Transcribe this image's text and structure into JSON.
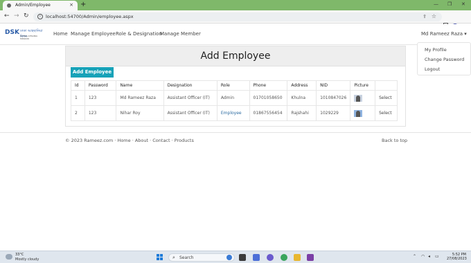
{
  "browser": {
    "tab_title": "Admin/Employee",
    "tab_close": "×",
    "new_tab": "+",
    "url": "localhost:54700/Admin/employee.aspx",
    "profile_initial": "P"
  },
  "site": {
    "logo_mark": "DSK",
    "logo_bengali": "ঢাকা আহছানিয়া মিশন",
    "logo_sub": "DHAKA AHSANIA MISSION",
    "nav": [
      "Home",
      "Manage Employee",
      "Role & Designation",
      "Manage Member"
    ],
    "user_name": "Md Rameez Raza",
    "user_caret": "▾",
    "dropdown": [
      "My Profile",
      "Change Password",
      "Logout"
    ]
  },
  "page": {
    "title": "Add Employee",
    "add_button": "Add Employee",
    "columns": [
      "Id",
      "Password",
      "Name",
      "Designation",
      "Role",
      "Phone",
      "Address",
      "NID",
      "Picture",
      ""
    ],
    "rows": [
      {
        "id": "1",
        "password": "123",
        "name": "Md Rameez Raza",
        "designation": "Assistant Officer (IT)",
        "role": "Admin",
        "phone": "01701058650",
        "address": "Khulna",
        "nid": "1010847026",
        "action": "Select"
      },
      {
        "id": "2",
        "password": "123",
        "name": "Nihar Roy",
        "designation": "Assistant Officer (IT)",
        "role": "Employee",
        "phone": "01867556454",
        "address": "Rajshahi",
        "nid": "1029229",
        "action": "Select"
      }
    ]
  },
  "footer": {
    "copyright": "© 2023 Rameez.com ·",
    "links": [
      "Home",
      "About",
      "Contact",
      "Products"
    ],
    "back_to_top": "Back to top"
  },
  "taskbar": {
    "temp": "33°C",
    "condition": "Mostly cloudy",
    "search": "Search",
    "time": "5:52 PM",
    "date": "27/08/2023"
  },
  "colors": {
    "accent": "#17a2b8",
    "tabbar": "#7fb86a",
    "link_blue": "#2a6aa0"
  }
}
